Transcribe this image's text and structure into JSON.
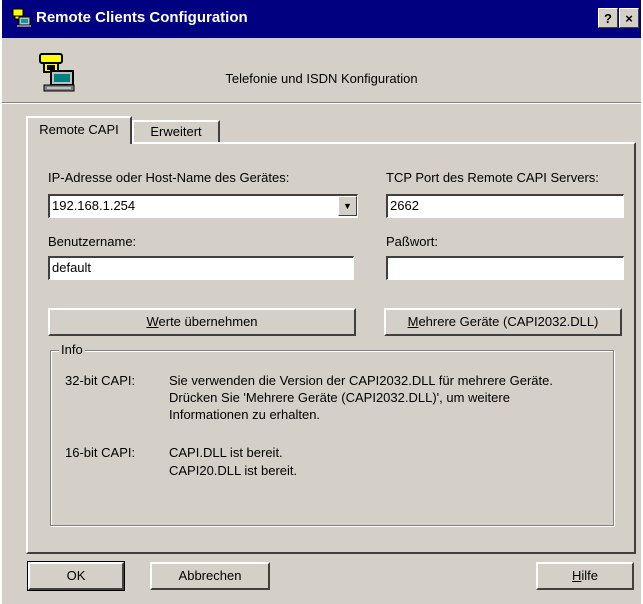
{
  "window": {
    "title": "Remote Clients Configuration",
    "help_button": "?",
    "close_button": "×"
  },
  "header": {
    "text": "Telefonie und ISDN Konfiguration"
  },
  "tabs": [
    {
      "label": "Remote CAPI",
      "active": true
    },
    {
      "label": "Erweitert",
      "active": false
    }
  ],
  "form": {
    "ip_label": "IP-Adresse oder Host-Name des Gerätes:",
    "ip_value": "192.168.1.254",
    "port_label": "TCP Port des Remote CAPI Servers:",
    "port_value": "2662",
    "user_label": "Benutzername:",
    "user_value": "default",
    "password_label": "Paßwort:",
    "password_value": ""
  },
  "buttons": {
    "apply_prefix": "",
    "apply_mnemonic": "W",
    "apply_rest": "erte übernehmen",
    "multi_mnemonic": "M",
    "multi_rest": "ehrere Geräte (CAPI2032.DLL)",
    "ok": "OK",
    "cancel": "Abbrechen",
    "help_mnemonic": "H",
    "help_rest": "ilfe"
  },
  "info": {
    "title": "Info",
    "capi32_label": "32-bit CAPI:",
    "capi32_lines": [
      "Sie verwenden die Version der CAPI2032.DLL für mehrere Geräte.",
      "Drücken Sie 'Mehrere Geräte (CAPI2032.DLL)', um weitere",
      "Informationen zu erhalten."
    ],
    "capi16_label": "16-bit CAPI:",
    "capi16_lines": [
      "CAPI.DLL ist bereit.",
      "CAPI20.DLL ist bereit."
    ]
  },
  "icons": {
    "title_icon": "phone-computer-icon",
    "header_icon": "telephone-computer-icon",
    "dropdown_icon": "chevron-down-icon"
  },
  "colors": {
    "titlebar": "#000080",
    "face": "#d4d0c8"
  }
}
